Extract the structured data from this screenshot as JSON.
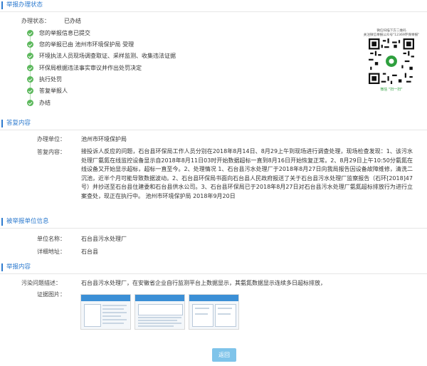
{
  "status_section": {
    "title": "举报办理状态",
    "status_label": "办理状态：",
    "status_value": "已办结",
    "steps": [
      "您的举报信息已提交",
      "您的举报已由 池州市环境保护局 受理",
      "环境执法人员现场调查取证、采样监测、收集违法证据",
      "环保局根据违法事实审议并作出处罚决定",
      "执行处罚",
      "答复举报人",
      "办结"
    ],
    "qr": {
      "caption_top": "微信扫描下方二维码",
      "caption_mid": "关注微信举报公众号\"12369环保举报\"",
      "caption_bottom": "微信 \"扫一扫\""
    }
  },
  "reply_section": {
    "title": "答复内容",
    "unit_label": "办理单位：",
    "unit_value": "池州市环境保护局",
    "content_label": "答复内容：",
    "content_value": "接投诉人反应的问题，石台县环保局工作人员分别在2018年8月14日、8月29上午到现场进行调查处理，现场检查发现：1、该污水处理厂氨氮在线监控设备显示自2018年8月11日03时开始数据超标一直到8月16日开始恢复正常。2、8月29日上午10:50分氨氮在线设备又开始显示超标，超标一直至今。2、处理情况 1、石台县污水处理厂于2018年8月27日向我局报告因设备故障维修，清洗二沉池，近半个月可能导致数据波动。2、石台县环保局书面向石台县人民政府报送了关于石台县污水处理厂监察报告（石环[2018]47号）并抄送至石台县住建委和石台县供水公司。3、石台县环保局已于2018年8月27日对石台县污水处理厂氨氮超标排放行为进行立案查处，现正在执行中。 池州市环境保护局 2018年9月20日"
  },
  "reported_unit_section": {
    "title": "被举报单位信息",
    "name_label": "单位名称：",
    "name_value": "石台县污水处理厂",
    "address_label": "详细地址：",
    "address_value": "石台县"
  },
  "report_section": {
    "title": "举报内容",
    "description_label": "污染问题描述：",
    "description_value": "石台县污水处理厂，在安徽省企业自行监测平台上数据显示，其氨氮数据显示连续多日超标排放，",
    "images_label": "证据图片：",
    "images": [
      "evidence-image-1",
      "evidence-image-2",
      "evidence-image-3"
    ]
  },
  "actions": {
    "back_label": "返回"
  },
  "colors": {
    "accent": "#2e7bcf",
    "step_green": "#5cb85c",
    "button": "#7fc4ea"
  }
}
